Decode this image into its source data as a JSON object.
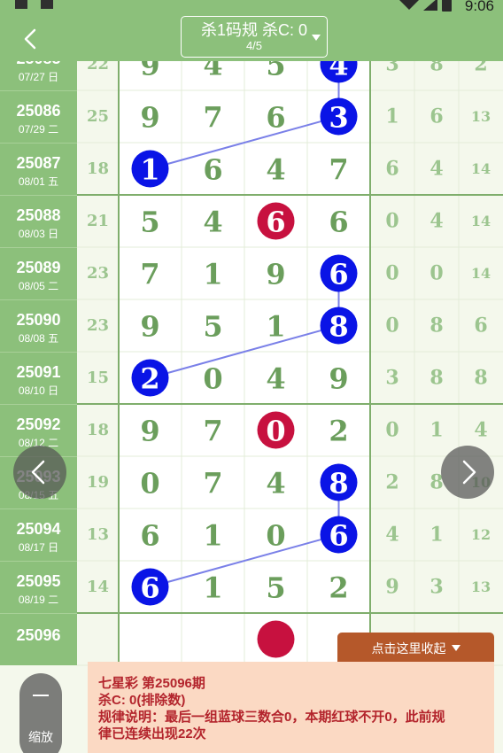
{
  "status_bar": {
    "time": "9:06"
  },
  "toolbar": {
    "title": "杀1码规 杀C: 0",
    "page": "4/5"
  },
  "grid": {
    "rows": [
      {
        "period": "25085",
        "date": "07/27 日",
        "sum": "22",
        "digits": [
          "9",
          "4",
          "5",
          "4"
        ],
        "blue_index": 3,
        "red_index": null,
        "tail": [
          "3",
          "8",
          "2"
        ],
        "partial": true
      },
      {
        "period": "25086",
        "date": "07/29 二",
        "sum": "25",
        "digits": [
          "9",
          "7",
          "6",
          "3"
        ],
        "blue_index": 3,
        "red_index": null,
        "tail": [
          "1",
          "6",
          "13"
        ]
      },
      {
        "period": "25087",
        "date": "08/01 五",
        "sum": "18",
        "digits": [
          "1",
          "6",
          "4",
          "7"
        ],
        "blue_index": 0,
        "red_index": null,
        "tail": [
          "6",
          "4",
          "14"
        ]
      },
      {
        "period": "25088",
        "date": "08/03 日",
        "sum": "21",
        "digits": [
          "5",
          "4",
          "6",
          "6"
        ],
        "blue_index": null,
        "red_index": 2,
        "tail": [
          "0",
          "4",
          "14"
        ]
      },
      {
        "period": "25089",
        "date": "08/05 二",
        "sum": "23",
        "digits": [
          "7",
          "1",
          "9",
          "6"
        ],
        "blue_index": 3,
        "red_index": null,
        "tail": [
          "0",
          "0",
          "14"
        ]
      },
      {
        "period": "25090",
        "date": "08/08 五",
        "sum": "23",
        "digits": [
          "9",
          "5",
          "1",
          "8"
        ],
        "blue_index": 3,
        "red_index": null,
        "tail": [
          "0",
          "8",
          "6"
        ]
      },
      {
        "period": "25091",
        "date": "08/10 日",
        "sum": "15",
        "digits": [
          "2",
          "0",
          "4",
          "9"
        ],
        "blue_index": 0,
        "red_index": null,
        "tail": [
          "3",
          "8",
          "8"
        ]
      },
      {
        "period": "25092",
        "date": "08/12 二",
        "sum": "18",
        "digits": [
          "9",
          "7",
          "0",
          "2"
        ],
        "blue_index": null,
        "red_index": 2,
        "tail": [
          "0",
          "1",
          "4"
        ]
      },
      {
        "period": "25093",
        "date": "08/15 五",
        "sum": "19",
        "digits": [
          "0",
          "7",
          "4",
          "8"
        ],
        "blue_index": 3,
        "red_index": null,
        "tail": [
          "2",
          "8",
          "10"
        ]
      },
      {
        "period": "25094",
        "date": "08/17 日",
        "sum": "13",
        "digits": [
          "6",
          "1",
          "0",
          "6"
        ],
        "blue_index": 3,
        "red_index": null,
        "tail": [
          "4",
          "1",
          "12"
        ]
      },
      {
        "period": "25095",
        "date": "08/19 二",
        "sum": "14",
        "digits": [
          "6",
          "1",
          "5",
          "2"
        ],
        "blue_index": 0,
        "red_index": null,
        "tail": [
          "9",
          "3",
          "13"
        ]
      },
      {
        "period": "25096",
        "date": "",
        "sum": "",
        "digits": [
          "",
          "",
          "",
          ""
        ],
        "blue_index": null,
        "red_index": 2,
        "tail": [
          "",
          "",
          ""
        ],
        "pending": true
      }
    ]
  },
  "collapse_tab": {
    "label": "点击这里收起"
  },
  "info_panel": {
    "line1": "七星彩 第25096期",
    "line2": "杀C: 0(排除数)",
    "line3": "规律说明：最后一组蓝球三数合0，本期红球不开0，此前规",
    "line4": "律已连续出现22次"
  },
  "zoom": {
    "label": "缩放"
  },
  "colors": {
    "header_green": "#8cc07b",
    "cell_bg": "#ffffff",
    "tail_bg": "#f4f8ec",
    "digit_green": "#6b9e5c",
    "tail_green": "#9cc58f",
    "blue_ball": "#0a14e6",
    "red_ball": "#c7113f",
    "link_line": "#7a80e8",
    "panel_bg": "#fbd9c3",
    "panel_text": "#b3242c",
    "collapse_bg": "#b5582a"
  },
  "icons": [
    "chevron-left-icon",
    "chevron-right-icon",
    "caret-down-icon",
    "minus-icon",
    "wifi-icon",
    "signal-icon",
    "battery-icon"
  ]
}
